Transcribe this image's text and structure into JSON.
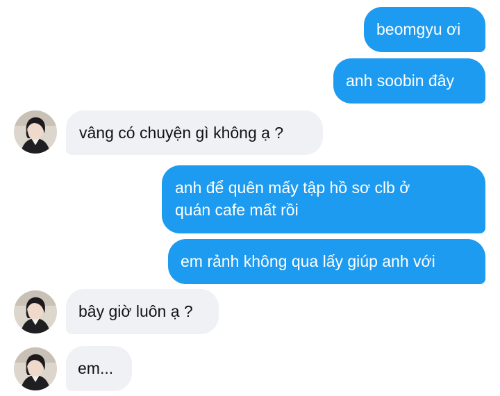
{
  "conversation": {
    "messages": [
      {
        "from": "me",
        "text": "beomgyu ơi"
      },
      {
        "from": "me",
        "text": "anh soobin đây"
      },
      {
        "from": "them",
        "text": "vâng có chuyện gì không ạ ?"
      },
      {
        "from": "me",
        "lines": [
          "anh để quên mấy tập hồ sơ clb ở",
          "quán cafe mất rồi"
        ]
      },
      {
        "from": "me",
        "text": "em rảnh không qua lấy giúp anh với"
      },
      {
        "from": "them",
        "text": "bây giờ luôn ạ ?"
      },
      {
        "from": "them",
        "text": "em..."
      }
    ]
  },
  "colors": {
    "sent_bubble": "#1d9bf0",
    "received_bubble": "#eff1f4",
    "sent_text": "#ffffff",
    "received_text": "#0f1419"
  },
  "icons": {
    "contact_avatar": "avatar-photo-icon"
  }
}
